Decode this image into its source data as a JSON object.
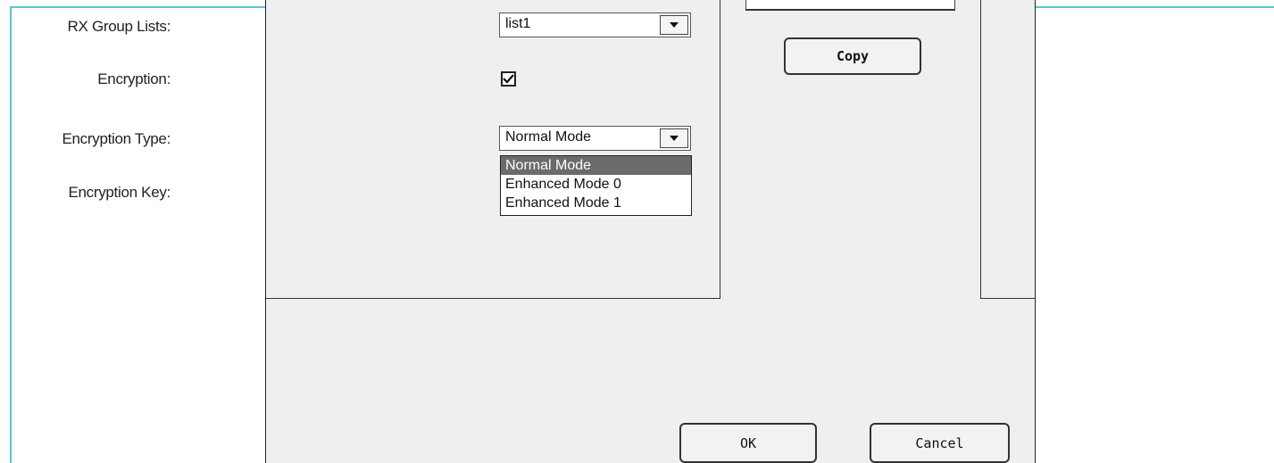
{
  "form": {
    "rx_group_lists_label": "RX Group Lists:",
    "rx_group_lists_value": "list1",
    "encryption_label": "Encryption:",
    "encryption_checked": true,
    "encryption_type_label": "Encryption Type:",
    "encryption_type_value": "Normal Mode",
    "encryption_key_label": "Encryption Key:",
    "encryption_type_options": [
      "Normal Mode",
      "Enhanced Mode 0",
      "Enhanced Mode 1"
    ],
    "highlighted_option": "Normal Mode"
  },
  "buttons": {
    "copy": "Copy",
    "ok": "OK",
    "cancel": "Cancel"
  },
  "icons": {
    "dropdown_arrow": "chevron-down-icon",
    "checkmark": "check-icon"
  },
  "colors": {
    "frame": "#5fc3cf",
    "dialog_bg": "#efefef",
    "highlight": "#6b6b6b"
  }
}
